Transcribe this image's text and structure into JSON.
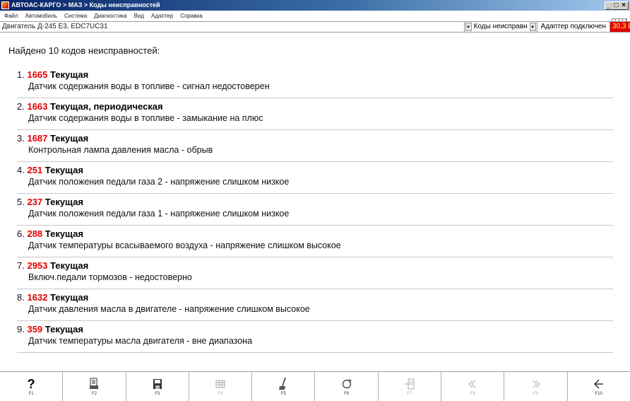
{
  "window": {
    "title": "АВТОАС-КАРГО > МАЗ > Коды неисправностей",
    "controls": "_ □ ×"
  },
  "menu": [
    "Файл",
    "Автомобиль",
    "Система",
    "Диагностика",
    "Вид",
    "Адаптер",
    "Справка"
  ],
  "info": {
    "engine": "Двигатель Д-245 Е3, EDC7UC31",
    "dropdown": "Коды неисправн",
    "adapter": "Адаптер подключен",
    "voltage": "30,3 В"
  },
  "summary": "Найдено 10 кодов неисправностей:",
  "faults": [
    {
      "num": "1.",
      "code": "1665",
      "status": "Текущая",
      "desc": "Датчик содержания воды в топливе - сигнал недостоверен"
    },
    {
      "num": "2.",
      "code": "1663",
      "status": "Текущая, периодическая",
      "desc": "Датчик содержания воды в топливе - замыкание на плюс"
    },
    {
      "num": "3.",
      "code": "1687",
      "status": "Текущая",
      "desc": "Контрольная лампа давления масла - обрыв"
    },
    {
      "num": "4.",
      "code": "251",
      "status": "Текущая",
      "desc": "Датчик положения педали газа 2 - напряжение слишком низкое"
    },
    {
      "num": "5.",
      "code": "237",
      "status": "Текущая",
      "desc": "Датчик положения педали газа 1 - напряжение слишком низкое"
    },
    {
      "num": "6.",
      "code": "288",
      "status": "Текущая",
      "desc": "Датчик температуры всасываемого воздуха - напряжение слишком высокое"
    },
    {
      "num": "7.",
      "code": "2953",
      "status": "Текущая",
      "desc": "Включ.педали тормозов - недостоверно"
    },
    {
      "num": "8.",
      "code": "1632",
      "status": "Текущая",
      "desc": "Датчик давления масла в двигателе - напряжение слишком высокое"
    },
    {
      "num": "9.",
      "code": "359",
      "status": "Текущая",
      "desc": "Датчик температуры масла двигателя - вне диапазона"
    }
  ],
  "fkeys": [
    {
      "label": "F1",
      "icon": "help-icon",
      "enabled": true
    },
    {
      "label": "F2",
      "icon": "print-icon",
      "enabled": true
    },
    {
      "label": "F3",
      "icon": "save-icon",
      "enabled": true
    },
    {
      "label": "F4",
      "icon": "table-icon",
      "enabled": false
    },
    {
      "label": "F5",
      "icon": "clear-codes-icon",
      "enabled": true
    },
    {
      "label": "F6",
      "icon": "refresh-icon",
      "enabled": true
    },
    {
      "label": "F7",
      "icon": "freeze-frame-icon",
      "enabled": false
    },
    {
      "label": "F8",
      "icon": "prev-icon",
      "enabled": false
    },
    {
      "label": "F9",
      "icon": "next-icon",
      "enabled": false
    },
    {
      "label": "F10",
      "icon": "exit-icon",
      "enabled": true
    }
  ],
  "colors": {
    "code": "#e00000",
    "voltage_bg": "#e00000",
    "voltage_fg": "#ffff66"
  }
}
